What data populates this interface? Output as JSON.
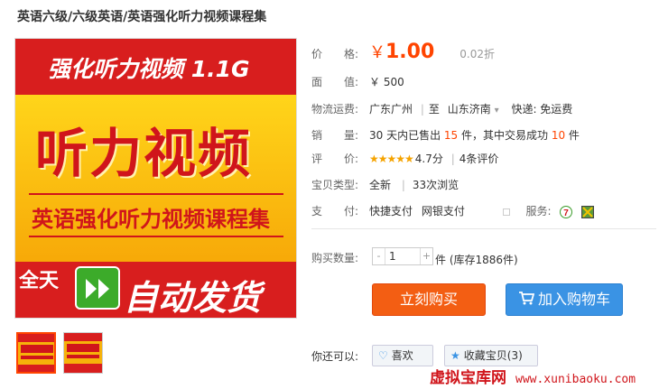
{
  "product": {
    "title": "英语六级/六级英语/英语强化听力视频课程集"
  },
  "image": {
    "banner_top": "强化听力视频 1.1G",
    "big_text": "听力视频",
    "sub_text": "英语强化听力视频课程集",
    "all_day": "全天",
    "auto_ship": "自动发货"
  },
  "info": {
    "price_label": "价　　格:",
    "price_symbol": "￥",
    "price": "1.00",
    "discount": "0.02折",
    "face_label": "面　　值:",
    "face_value": "￥ 500",
    "shipping_label": "物流运费:",
    "ship_from": "广东广州",
    "ship_sep": "|",
    "ship_to_word": "至",
    "ship_to": "山东济南",
    "ship_arrow": "▾",
    "shipping_cost": "快递: 免运费",
    "sales_label": "销　　量:",
    "sales_pre": "30 天内已售出 ",
    "sales_count": "15",
    "sales_mid": " 件，其中交易成功 ",
    "sales_success": "10",
    "sales_post": " 件",
    "rating_label": "评　　价:",
    "stars": "★★★★★",
    "rating": "4.7分",
    "reviews": "4条评价",
    "type_label": "宝贝类型:",
    "condition": "全新",
    "views": "33次浏览",
    "pay_label": "支　　付:",
    "pay_method1": "快捷支付",
    "pay_method2": "网银支付",
    "service_label": "服务:",
    "qty_label": "购买数量:",
    "qty_value": "1",
    "qty_minus": "-",
    "qty_plus": "+",
    "stock_text": "件 (库存1886件)",
    "buy_now": "立刻购买",
    "add_cart": "加入购物车",
    "also_label": "你还可以:",
    "like": "喜欢",
    "favorite": "收藏宝贝(3)"
  },
  "watermark": {
    "cn": "虚拟宝库网",
    "url": "www.xunibaoku.com"
  },
  "colors": {
    "accent": "#f40",
    "buy": "#f35e13",
    "cart": "#3a93e4"
  }
}
